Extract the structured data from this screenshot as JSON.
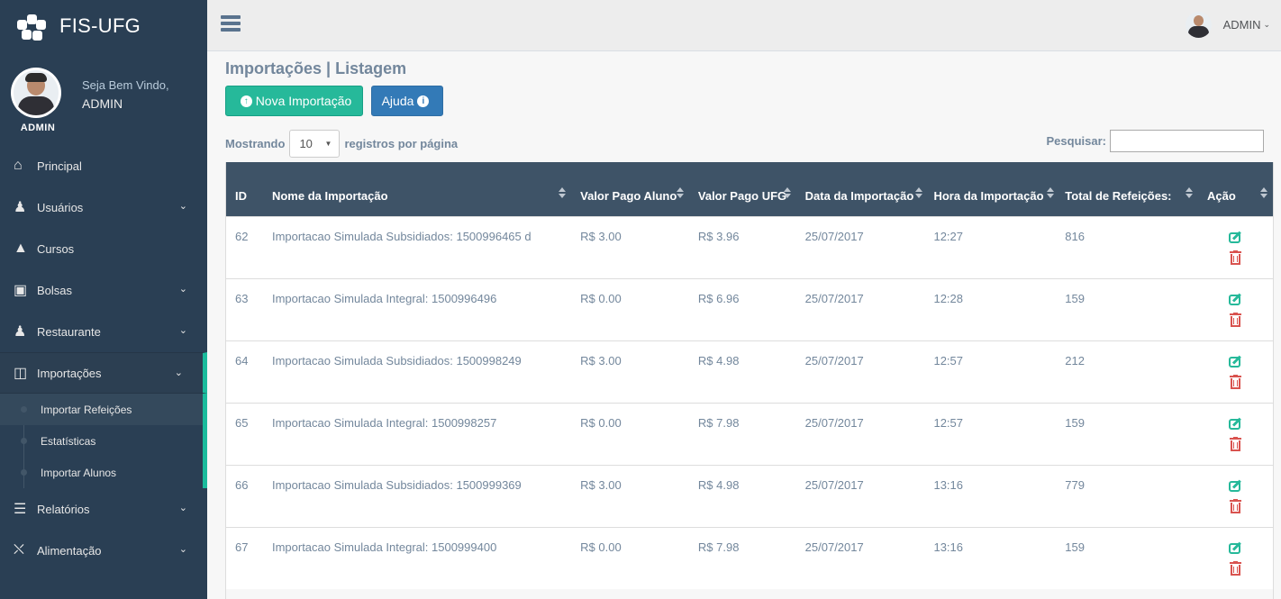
{
  "brand": {
    "title": "FIS-UFG"
  },
  "profile": {
    "welcome": "Seja Bem Vindo,",
    "user": "ADMIN",
    "badge": "ADMIN"
  },
  "sidebar": {
    "items": [
      {
        "label": "Principal",
        "icon": "home-icon"
      },
      {
        "label": "Usuários",
        "icon": "user-icon"
      },
      {
        "label": "Cursos",
        "icon": "graduation-cap-icon"
      },
      {
        "label": "Bolsas",
        "icon": "briefcase-icon"
      },
      {
        "label": "Restaurante",
        "icon": "user-icon"
      },
      {
        "label": "Importações",
        "icon": "file-import-icon"
      },
      {
        "label": "Relatórios",
        "icon": "list-icon"
      },
      {
        "label": "Alimentação",
        "icon": "cutlery-icon"
      }
    ],
    "submenu": [
      "Importar Refeições",
      "Estatísticas",
      "Importar Alunos"
    ]
  },
  "topnav": {
    "user": "ADMIN"
  },
  "page": {
    "title": "Importações | Listagem",
    "new_button": "Nova Importação",
    "help_button": "Ajuda",
    "length_prefix": "Mostrando",
    "length_value": "10",
    "length_suffix": "registros por página",
    "search_label": "Pesquisar:",
    "search_value": ""
  },
  "table": {
    "columns": [
      "ID",
      "Nome da Importação",
      "Valor Pago Aluno",
      "Valor Pago UFG",
      "Data da Importação",
      "Hora da Importação",
      "Total de Refeições:",
      "Ação"
    ],
    "rows": [
      {
        "id": "62",
        "name": "Importacao Simulada Subsidiados: 1500996465 d",
        "aluno": "R$ 3.00",
        "ufg": "R$ 3.96",
        "data": "25/07/2017",
        "hora": "12:27",
        "total": "816"
      },
      {
        "id": "63",
        "name": "Importacao Simulada Integral: 1500996496",
        "aluno": "R$ 0.00",
        "ufg": "R$ 6.96",
        "data": "25/07/2017",
        "hora": "12:28",
        "total": "159"
      },
      {
        "id": "64",
        "name": "Importacao Simulada Subsidiados: 1500998249",
        "aluno": "R$ 3.00",
        "ufg": "R$ 4.98",
        "data": "25/07/2017",
        "hora": "12:57",
        "total": "212"
      },
      {
        "id": "65",
        "name": "Importacao Simulada Integral: 1500998257",
        "aluno": "R$ 0.00",
        "ufg": "R$ 7.98",
        "data": "25/07/2017",
        "hora": "12:57",
        "total": "159"
      },
      {
        "id": "66",
        "name": "Importacao Simulada Subsidiados: 1500999369",
        "aluno": "R$ 3.00",
        "ufg": "R$ 4.98",
        "data": "25/07/2017",
        "hora": "13:16",
        "total": "779"
      },
      {
        "id": "67",
        "name": "Importacao Simulada Integral: 1500999400",
        "aluno": "R$ 0.00",
        "ufg": "R$ 7.98",
        "data": "25/07/2017",
        "hora": "13:16",
        "total": "159"
      }
    ]
  },
  "colors": {
    "sidebar": "#2a3f54",
    "accent": "#1abb9c",
    "success": "#26b99a",
    "primary": "#337ab7",
    "danger": "#d9534f",
    "table_header": "#3e5367"
  }
}
